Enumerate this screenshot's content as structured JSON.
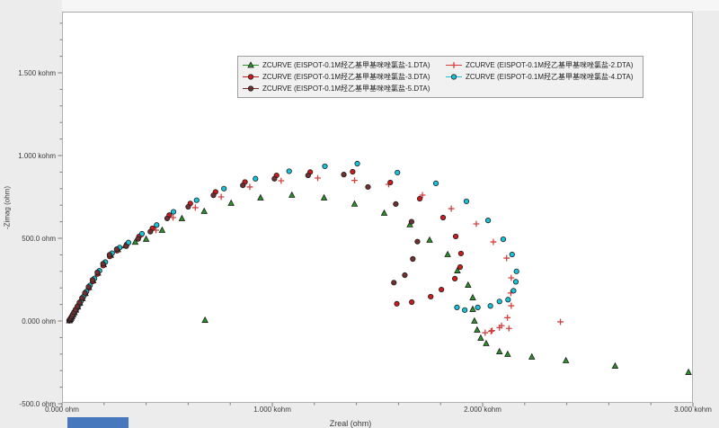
{
  "axis": {
    "x_title": "Zreal (ohm)",
    "y_title": "-Zimag (ohm)"
  },
  "chart_data": {
    "type": "scatter",
    "title": "",
    "xlabel": "Zreal (ohm)",
    "ylabel": "-Zimag (ohm)",
    "xlim": [
      0,
      3000
    ],
    "ylim": [
      -500,
      1870
    ],
    "grid": false,
    "legend_position": "top-center",
    "x_ticks": {
      "values": [
        0,
        1000,
        2000,
        3000
      ],
      "labels": [
        "0.000 ohm",
        "1.000 kohm",
        "2.000 kohm",
        "3.000 kohm"
      ],
      "minor_step": 200
    },
    "y_ticks": {
      "values": [
        -500,
        0,
        500,
        1000,
        1500
      ],
      "labels": [
        "-500.0 ohm",
        "0.000 ohm",
        "500.0 ohm",
        "1.000 kohm",
        "1.500 kohm"
      ],
      "minor_step": 100
    },
    "series": [
      {
        "name": "ZCURVE (EISPOT-0.1M羟乙基甲基咪唑氯盐-1.DTA)",
        "marker": "triangle",
        "color": "#2a9327",
        "points": [
          [
            35,
            2
          ],
          [
            37,
            6
          ],
          [
            40,
            11
          ],
          [
            44,
            18
          ],
          [
            48,
            27
          ],
          [
            53,
            38
          ],
          [
            59,
            51
          ],
          [
            66,
            67
          ],
          [
            75,
            86
          ],
          [
            85,
            109
          ],
          [
            97,
            136
          ],
          [
            111,
            167
          ],
          [
            128,
            203
          ],
          [
            148,
            244
          ],
          [
            171,
            290
          ],
          [
            198,
            341
          ],
          [
            232,
            398
          ],
          [
            266,
            432
          ],
          [
            300,
            455
          ],
          [
            348,
            477
          ],
          [
            400,
            495
          ],
          [
            476,
            549
          ],
          [
            570,
            620
          ],
          [
            676,
            663
          ],
          [
            804,
            712
          ],
          [
            944,
            745
          ],
          [
            1093,
            761
          ],
          [
            1246,
            745
          ],
          [
            1391,
            707
          ],
          [
            1532,
            652
          ],
          [
            1654,
            582
          ],
          [
            1748,
            489
          ],
          [
            1834,
            402
          ],
          [
            1880,
            304
          ],
          [
            1931,
            217
          ],
          [
            1953,
            141
          ],
          [
            1953,
            71
          ],
          [
            1961,
            0
          ],
          [
            1974,
            -54
          ],
          [
            1991,
            -103
          ],
          [
            2017,
            -136
          ],
          [
            2080,
            -185
          ],
          [
            2119,
            -201
          ],
          [
            2234,
            -217
          ],
          [
            2396,
            -239
          ],
          [
            2630,
            -272
          ],
          [
            2979,
            -310
          ],
          [
            680,
            5
          ]
        ]
      },
      {
        "name": "ZCURVE (EISPOT-0.1M羟乙基甲基咪唑氯盐-2.DTA)",
        "marker": "plus",
        "color": "#d24040",
        "points": [
          [
            36,
            3
          ],
          [
            38,
            7
          ],
          [
            41,
            13
          ],
          [
            45,
            20
          ],
          [
            49,
            29
          ],
          [
            54,
            41
          ],
          [
            61,
            55
          ],
          [
            68,
            71
          ],
          [
            77,
            91
          ],
          [
            87,
            115
          ],
          [
            99,
            142
          ],
          [
            114,
            174
          ],
          [
            131,
            211
          ],
          [
            152,
            253
          ],
          [
            176,
            300
          ],
          [
            203,
            352
          ],
          [
            235,
            404
          ],
          [
            270,
            438
          ],
          [
            310,
            468
          ],
          [
            372,
            510
          ],
          [
            447,
            549
          ],
          [
            528,
            625
          ],
          [
            634,
            685
          ],
          [
            757,
            750
          ],
          [
            893,
            810
          ],
          [
            1042,
            848
          ],
          [
            1216,
            864
          ],
          [
            1391,
            850
          ],
          [
            1553,
            826
          ],
          [
            1714,
            761
          ],
          [
            1851,
            679
          ],
          [
            1970,
            587
          ],
          [
            2051,
            478
          ],
          [
            2114,
            380
          ],
          [
            2136,
            261
          ],
          [
            2134,
            169
          ],
          [
            2136,
            92
          ],
          [
            2118,
            20
          ],
          [
            2080,
            -40
          ],
          [
            2040,
            -62
          ],
          [
            2012,
            -71
          ],
          [
            2045,
            -58
          ],
          [
            2090,
            -28
          ],
          [
            2125,
            -45
          ],
          [
            2370,
            -5
          ]
        ]
      },
      {
        "name": "ZCURVE (EISPOT-0.1M羟乙基甲基咪唑氯盐-3.DTA)",
        "marker": "circle",
        "color": "#cc1c1c",
        "points": [
          [
            34,
            2
          ],
          [
            36,
            6
          ],
          [
            39,
            11
          ],
          [
            43,
            17
          ],
          [
            47,
            26
          ],
          [
            52,
            37
          ],
          [
            58,
            50
          ],
          [
            65,
            65
          ],
          [
            74,
            84
          ],
          [
            84,
            106
          ],
          [
            96,
            133
          ],
          [
            110,
            163
          ],
          [
            127,
            198
          ],
          [
            146,
            239
          ],
          [
            169,
            284
          ],
          [
            196,
            335
          ],
          [
            227,
            390
          ],
          [
            262,
            425
          ],
          [
            308,
            462
          ],
          [
            366,
            510
          ],
          [
            430,
            560
          ],
          [
            510,
            640
          ],
          [
            610,
            710
          ],
          [
            730,
            780
          ],
          [
            870,
            840
          ],
          [
            1020,
            880
          ],
          [
            1180,
            900
          ],
          [
            1382,
            902
          ],
          [
            1561,
            837
          ],
          [
            1701,
            739
          ],
          [
            1812,
            625
          ],
          [
            1872,
            511
          ],
          [
            1897,
            408
          ],
          [
            1893,
            326
          ],
          [
            1868,
            256
          ],
          [
            1804,
            190
          ],
          [
            1753,
            147
          ],
          [
            1663,
            114
          ],
          [
            1592,
            104
          ]
        ]
      },
      {
        "name": "ZCURVE (EISPOT-0.1M羟乙基甲基咪唑氯盐-4.DTA)",
        "marker": "circle",
        "color": "#16c4da",
        "points": [
          [
            36,
            4
          ],
          [
            38,
            8
          ],
          [
            41,
            14
          ],
          [
            45,
            21
          ],
          [
            50,
            31
          ],
          [
            55,
            43
          ],
          [
            62,
            57
          ],
          [
            69,
            74
          ],
          [
            78,
            94
          ],
          [
            89,
            118
          ],
          [
            101,
            146
          ],
          [
            116,
            178
          ],
          [
            133,
            215
          ],
          [
            154,
            257
          ],
          [
            178,
            304
          ],
          [
            206,
            356
          ],
          [
            238,
            410
          ],
          [
            274,
            444
          ],
          [
            316,
            474
          ],
          [
            380,
            527
          ],
          [
            450,
            580
          ],
          [
            530,
            660
          ],
          [
            640,
            730
          ],
          [
            770,
            800
          ],
          [
            920,
            860
          ],
          [
            1080,
            905
          ],
          [
            1250,
            935
          ],
          [
            1404,
            951
          ],
          [
            1595,
            897
          ],
          [
            1778,
            832
          ],
          [
            1923,
            723
          ],
          [
            2026,
            608
          ],
          [
            2098,
            494
          ],
          [
            2140,
            402
          ],
          [
            2161,
            300
          ],
          [
            2158,
            237
          ],
          [
            2147,
            183
          ],
          [
            2121,
            129
          ],
          [
            2080,
            118
          ],
          [
            2037,
            91
          ],
          [
            1977,
            82
          ],
          [
            1915,
            66
          ],
          [
            1878,
            82
          ]
        ]
      },
      {
        "name": "ZCURVE (EISPOT-0.1M羟乙基甲基咪唑氯盐-5.DTA)",
        "marker": "circle",
        "color": "#713030",
        "points": [
          [
            34,
            3
          ],
          [
            36,
            7
          ],
          [
            39,
            12
          ],
          [
            42,
            19
          ],
          [
            46,
            28
          ],
          [
            51,
            39
          ],
          [
            57,
            53
          ],
          [
            64,
            69
          ],
          [
            73,
            88
          ],
          [
            83,
            112
          ],
          [
            95,
            139
          ],
          [
            109,
            170
          ],
          [
            126,
            206
          ],
          [
            145,
            248
          ],
          [
            168,
            294
          ],
          [
            195,
            346
          ],
          [
            226,
            400
          ],
          [
            260,
            434
          ],
          [
            305,
            452
          ],
          [
            362,
            496
          ],
          [
            420,
            540
          ],
          [
            500,
            620
          ],
          [
            600,
            690
          ],
          [
            720,
            760
          ],
          [
            860,
            820
          ],
          [
            1010,
            860
          ],
          [
            1170,
            880
          ],
          [
            1340,
            885
          ],
          [
            1455,
            810
          ],
          [
            1587,
            707
          ],
          [
            1662,
            600
          ],
          [
            1690,
            480
          ],
          [
            1668,
            375
          ],
          [
            1630,
            277
          ],
          [
            1578,
            232
          ]
        ]
      }
    ]
  },
  "colors": {
    "background": "#ececec",
    "plot_background": "#ffffff",
    "frame_border": "#b0b0b0",
    "tick": "#7a7a7a",
    "label": "#3c3c3c",
    "legend_background": "#f1f1f1",
    "status_bar_item": "#4678bd"
  }
}
